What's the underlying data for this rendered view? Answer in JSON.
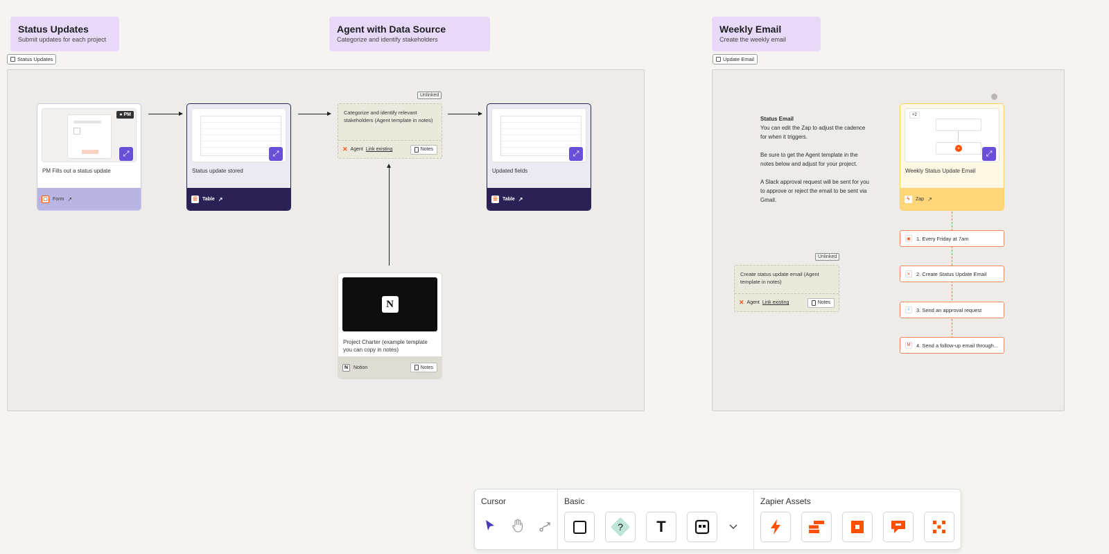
{
  "stickies": [
    {
      "title": "Status Updates",
      "subtitle": "Submit updates for each project"
    },
    {
      "title": "Agent with Data Source",
      "subtitle": "Categorize and identify stakeholders"
    },
    {
      "title": "Weekly Email",
      "subtitle": "Create the weekly email"
    }
  ],
  "groups": {
    "left_label": "Status Updates",
    "right_label": "Update Email"
  },
  "cards": {
    "form": {
      "title": "PM Fills out a status update",
      "app": "Form",
      "badge": "PM"
    },
    "table1": {
      "title": "Status update stored",
      "app": "Table"
    },
    "table2": {
      "title": "Updated fields",
      "app": "Table"
    },
    "notion": {
      "title": "Project Charter (example template you can copy in notes)",
      "app": "Notion",
      "notes": "Notes"
    },
    "zap": {
      "title": "Weekly Status Update Email",
      "app": "Zap",
      "thumb_badge": "+2"
    }
  },
  "agents": {
    "categorize": {
      "badge": "Unlinked",
      "description": "Categorize and identify relevant stakeholders (Agent template in notes)",
      "agent_label": "Agent",
      "link_label": "Link existing",
      "notes": "Notes"
    },
    "email": {
      "badge": "Unlinked",
      "description": "Create status update email (Agent template in notes)",
      "agent_label": "Agent",
      "link_label": "Link existing",
      "notes": "Notes"
    }
  },
  "note_text": {
    "title": "Status Email",
    "p1": "You can edit the Zap to adjust the cadence for when it triggers.",
    "p2": "Be sure to get the Agent template in the notes below and adjust for your project.",
    "p3": "A Slack approval request will be sent for you to approve or reject the email to be sent via Gmail."
  },
  "steps": [
    {
      "label": "1. Every Friday at 7am"
    },
    {
      "label": "2. Create Status Update Email"
    },
    {
      "label": "3. Send an approval request"
    },
    {
      "label": "4. Send a follow-up email through..."
    }
  ],
  "toolbar": {
    "sections": {
      "cursor": "Cursor",
      "basic": "Basic",
      "assets": "Zapier Assets"
    }
  },
  "colors": {
    "accent": "#6a4fd9",
    "zapier_orange": "#ff4f00",
    "table_dark": "#2b2154",
    "form_purple": "#b9b5e2",
    "zap_yellow": "#ffd77a"
  }
}
